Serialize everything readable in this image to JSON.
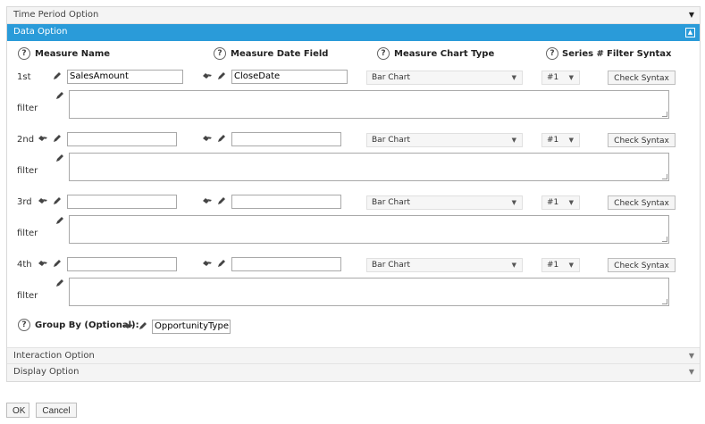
{
  "sections": {
    "time_period": "Time Period Option",
    "data_option": "Data Option",
    "interaction": "Interaction Option",
    "display": "Display Option"
  },
  "columns": {
    "measure_name": "Measure Name",
    "measure_date_field": "Measure Date Field",
    "measure_chart_type": "Measure Chart Type",
    "series": "Series #",
    "filter_syntax": "Filter Syntax"
  },
  "help_glyph": "?",
  "filter_label": "filter",
  "rows": [
    {
      "label": "1st",
      "measure_name": "SalesAmount",
      "date_field": "CloseDate",
      "chart_type": "Bar Chart",
      "series": "#1",
      "check_label": "Check Syntax"
    },
    {
      "label": "2nd",
      "measure_name": "",
      "date_field": "",
      "chart_type": "Bar Chart",
      "series": "#1",
      "check_label": "Check Syntax"
    },
    {
      "label": "3rd",
      "measure_name": "",
      "date_field": "",
      "chart_type": "Bar Chart",
      "series": "#1",
      "check_label": "Check Syntax"
    },
    {
      "label": "4th",
      "measure_name": "",
      "date_field": "",
      "chart_type": "Bar Chart",
      "series": "#1",
      "check_label": "Check Syntax"
    }
  ],
  "group_by": {
    "label": "Group By (Optional):",
    "value": "OpportunityType"
  },
  "footer": {
    "ok": "OK",
    "cancel": "Cancel"
  }
}
